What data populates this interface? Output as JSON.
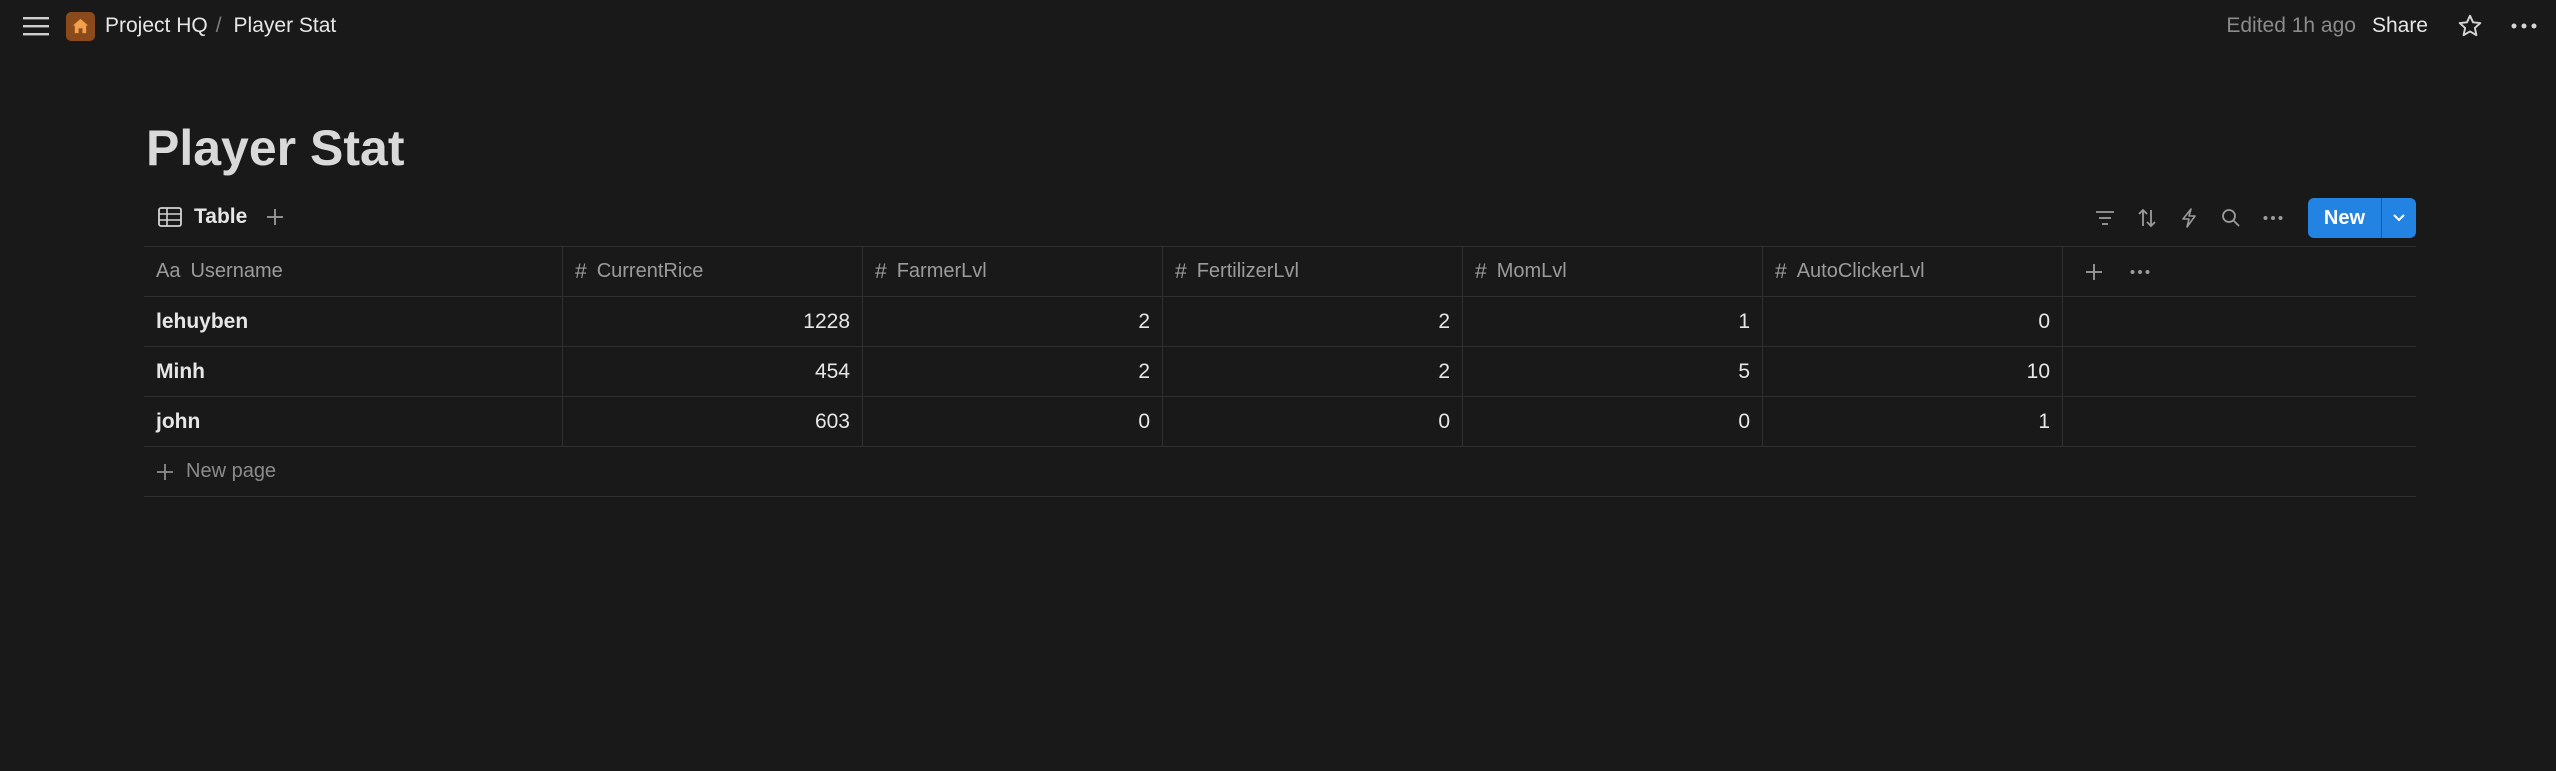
{
  "topbar": {
    "breadcrumb": [
      "Project HQ",
      "Player Stat"
    ],
    "separator": "/",
    "edited": "Edited 1h ago",
    "share_label": "Share"
  },
  "page": {
    "title": "Player Stat"
  },
  "view": {
    "tab_label": "Table",
    "new_label": "New"
  },
  "table": {
    "columns": [
      {
        "icon": "Aa",
        "label": "Username"
      },
      {
        "icon": "#",
        "label": "CurrentRice"
      },
      {
        "icon": "#",
        "label": "FarmerLvl"
      },
      {
        "icon": "#",
        "label": "FertilizerLvl"
      },
      {
        "icon": "#",
        "label": "MomLvl"
      },
      {
        "icon": "#",
        "label": "AutoClickerLvl"
      }
    ],
    "rows": [
      [
        "lehuyben",
        "1228",
        "2",
        "2",
        "1",
        "0"
      ],
      [
        "Minh",
        "454",
        "2",
        "2",
        "5",
        "10"
      ],
      [
        "john",
        "603",
        "0",
        "0",
        "0",
        "1"
      ]
    ],
    "new_page_label": "New page"
  },
  "colors": {
    "accent": "#2383e2",
    "background": "#191919",
    "home_tile": "#8a4a1c"
  },
  "icons": [
    "menu-icon",
    "home-icon",
    "star-icon",
    "more-icon",
    "table-icon",
    "plus-icon",
    "filter-icon",
    "sort-icon",
    "lightning-icon",
    "search-icon",
    "chevron-down-icon"
  ]
}
